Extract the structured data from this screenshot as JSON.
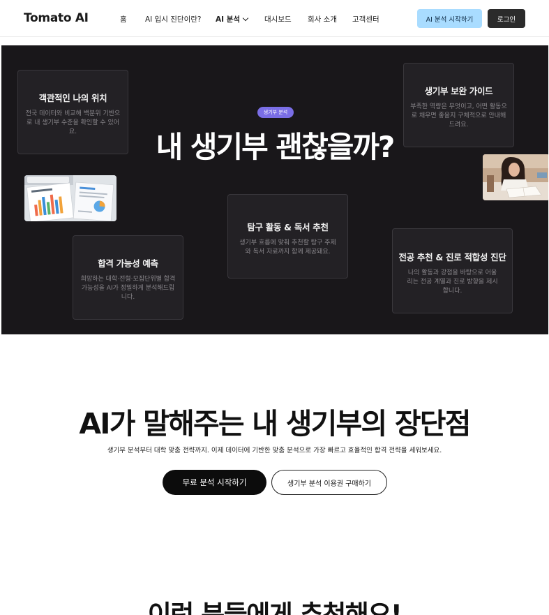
{
  "header": {
    "logo": "Tomato AI",
    "nav": [
      "홈",
      "AI 입시 진단이란?",
      "AI 분석",
      "대시보드",
      "회사 소개",
      "고객센터"
    ],
    "start_button": "AI 분석 시작하기",
    "login_button": "로그인"
  },
  "hero": {
    "badge": "생기부 분석",
    "title": "내 생기부 괜찮을까?",
    "cards": [
      {
        "title": "객관적인 나의 위치",
        "desc": "전국 데이터와 비교해 백분위 기반으로 내 생기부 수준을 확인할 수 있어요."
      },
      {
        "title": "생기부 보완 가이드",
        "desc": "부족한 역량은 무엇이고, 어떤 활동으로 채우면 좋을지 구체적으로 안내해드려요."
      },
      {
        "title": "탐구 활동 & 독서 추천",
        "desc": "생기부 흐름에 맞춰 추천할 탐구 주제와 독서 자료까지 함께 제공돼요."
      },
      {
        "title": "합격 가능성 예측",
        "desc": "희망하는 대학·전형·모집단위별 합격 가능성을 AI가 정밀하게 분석해드립니다."
      },
      {
        "title": "전공 추천 & 진로 적합성 진단",
        "desc": "나의 활동과 강점을 바탕으로 어울리는 전공 계열과 진로 방향을 제시합니다."
      }
    ]
  },
  "section2": {
    "title": "AI가 말해주는 내 생기부의 장단점",
    "subtitle": "생기부 분석부터 대학 맞춤 전략까지. 이제 데이터에 기반한 맞춤 분석으로 가장 빠르고 효율적인 합격 전략을 세워보세요.",
    "primary_button": "무료 분석 시작하기",
    "secondary_button": "생기부 분석 이용권 구매하기"
  },
  "section3": {
    "title": "이런 분들에게 추천해요!"
  }
}
